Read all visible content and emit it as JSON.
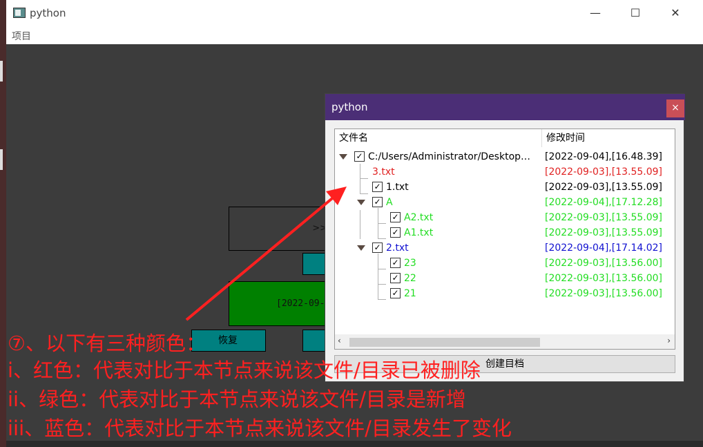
{
  "main_window": {
    "title": "python",
    "menu": [
      "项目"
    ],
    "controls": {
      "minimize": "—",
      "maximize": "☐",
      "close": "✕"
    },
    "bg_boxes": {
      "box1_text": ">>",
      "box3_text": "[2022-09-",
      "restore_label": "恢复"
    }
  },
  "dialog": {
    "title": "python",
    "close": "×",
    "tree": {
      "headers": {
        "name": "文件名",
        "time": "修改时间"
      },
      "rows": [
        {
          "name": "C:/Users/Administrator/Desktop…",
          "time": "[2022-09-04],[16.48.39]",
          "checked": true,
          "expanded": true,
          "depth": 0,
          "color": "#000000"
        },
        {
          "name": "3.txt",
          "time": "[2022-09-03],[13.55.09]",
          "checked": false,
          "depth": 1,
          "color": "#e02020"
        },
        {
          "name": "1.txt",
          "time": "[2022-09-03],[13.55.09]",
          "checked": true,
          "depth": 1,
          "color": "#000000"
        },
        {
          "name": "A",
          "time": "[2022-09-04],[17.12.28]",
          "checked": true,
          "expanded": true,
          "depth": 1,
          "color": "#22dd22"
        },
        {
          "name": "A2.txt",
          "time": "[2022-09-03],[13.55.09]",
          "checked": true,
          "depth": 2,
          "color": "#22dd22"
        },
        {
          "name": "A1.txt",
          "time": "[2022-09-03],[13.55.09]",
          "checked": true,
          "depth": 2,
          "color": "#22dd22"
        },
        {
          "name": "2.txt",
          "time": "[2022-09-04],[17.14.02]",
          "checked": true,
          "expanded": true,
          "depth": 1,
          "color": "#1010d0"
        },
        {
          "name": "23",
          "time": "[2022-09-03],[13.56.00]",
          "checked": true,
          "depth": 2,
          "color": "#22dd22"
        },
        {
          "name": "22",
          "time": "[2022-09-03],[13.56.00]",
          "checked": true,
          "depth": 2,
          "color": "#22dd22"
        },
        {
          "name": "21",
          "time": "[2022-09-03],[13.56.00]",
          "checked": true,
          "depth": 2,
          "color": "#22dd22"
        }
      ],
      "scroll": {
        "left": "‹",
        "right": "›"
      }
    },
    "button_label": "创建目档"
  },
  "annotations": {
    "line1": "⑦、以下有三种颜色：",
    "line2": "i、红色：代表对比于本节点来说该文件/目录已被删除",
    "line3": "ii、绿色：代表对比于本节点来说该文件/目录是新增",
    "line4": "iii、蓝色：代表对比于本节点来说该文件/目录发生了变化",
    "color": "#ff2020"
  },
  "checkmark": "✓"
}
